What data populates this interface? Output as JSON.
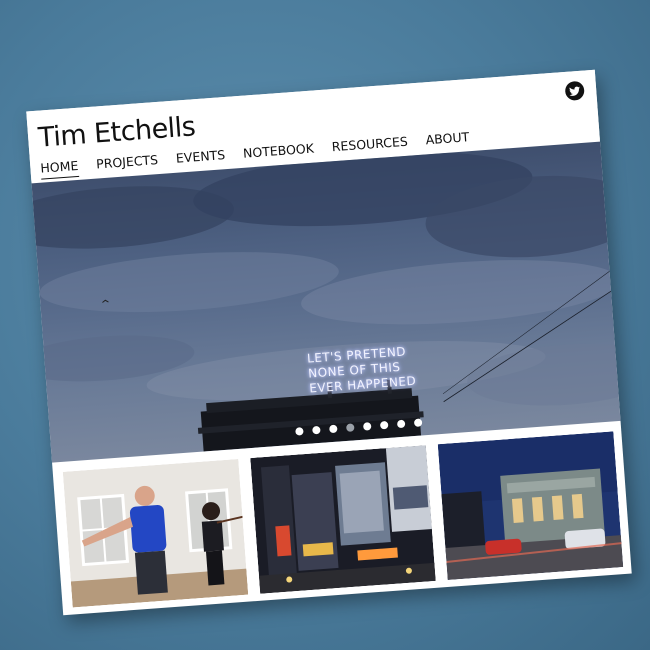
{
  "header": {
    "site_title": "Tim Etchells",
    "nav": [
      {
        "label": "HOME",
        "active": true
      },
      {
        "label": "PROJECTS"
      },
      {
        "label": "EVENTS"
      },
      {
        "label": "NOTEBOOK"
      },
      {
        "label": "RESOURCES"
      },
      {
        "label": "ABOUT"
      }
    ],
    "social_icon": "twitter-icon"
  },
  "hero": {
    "neon_lines": [
      "LET'S PRETEND",
      "NONE OF THIS",
      "EVER HAPPENED"
    ],
    "slide_count": 8,
    "active_slide": 4
  },
  "thumbnails": [
    {
      "subject": "performer with violinist in gallery"
    },
    {
      "subject": "times square billboards at night"
    },
    {
      "subject": "theatre square at dusk with traffic"
    }
  ],
  "colors": {
    "accent": "#111111",
    "background": "#4f82a3"
  }
}
